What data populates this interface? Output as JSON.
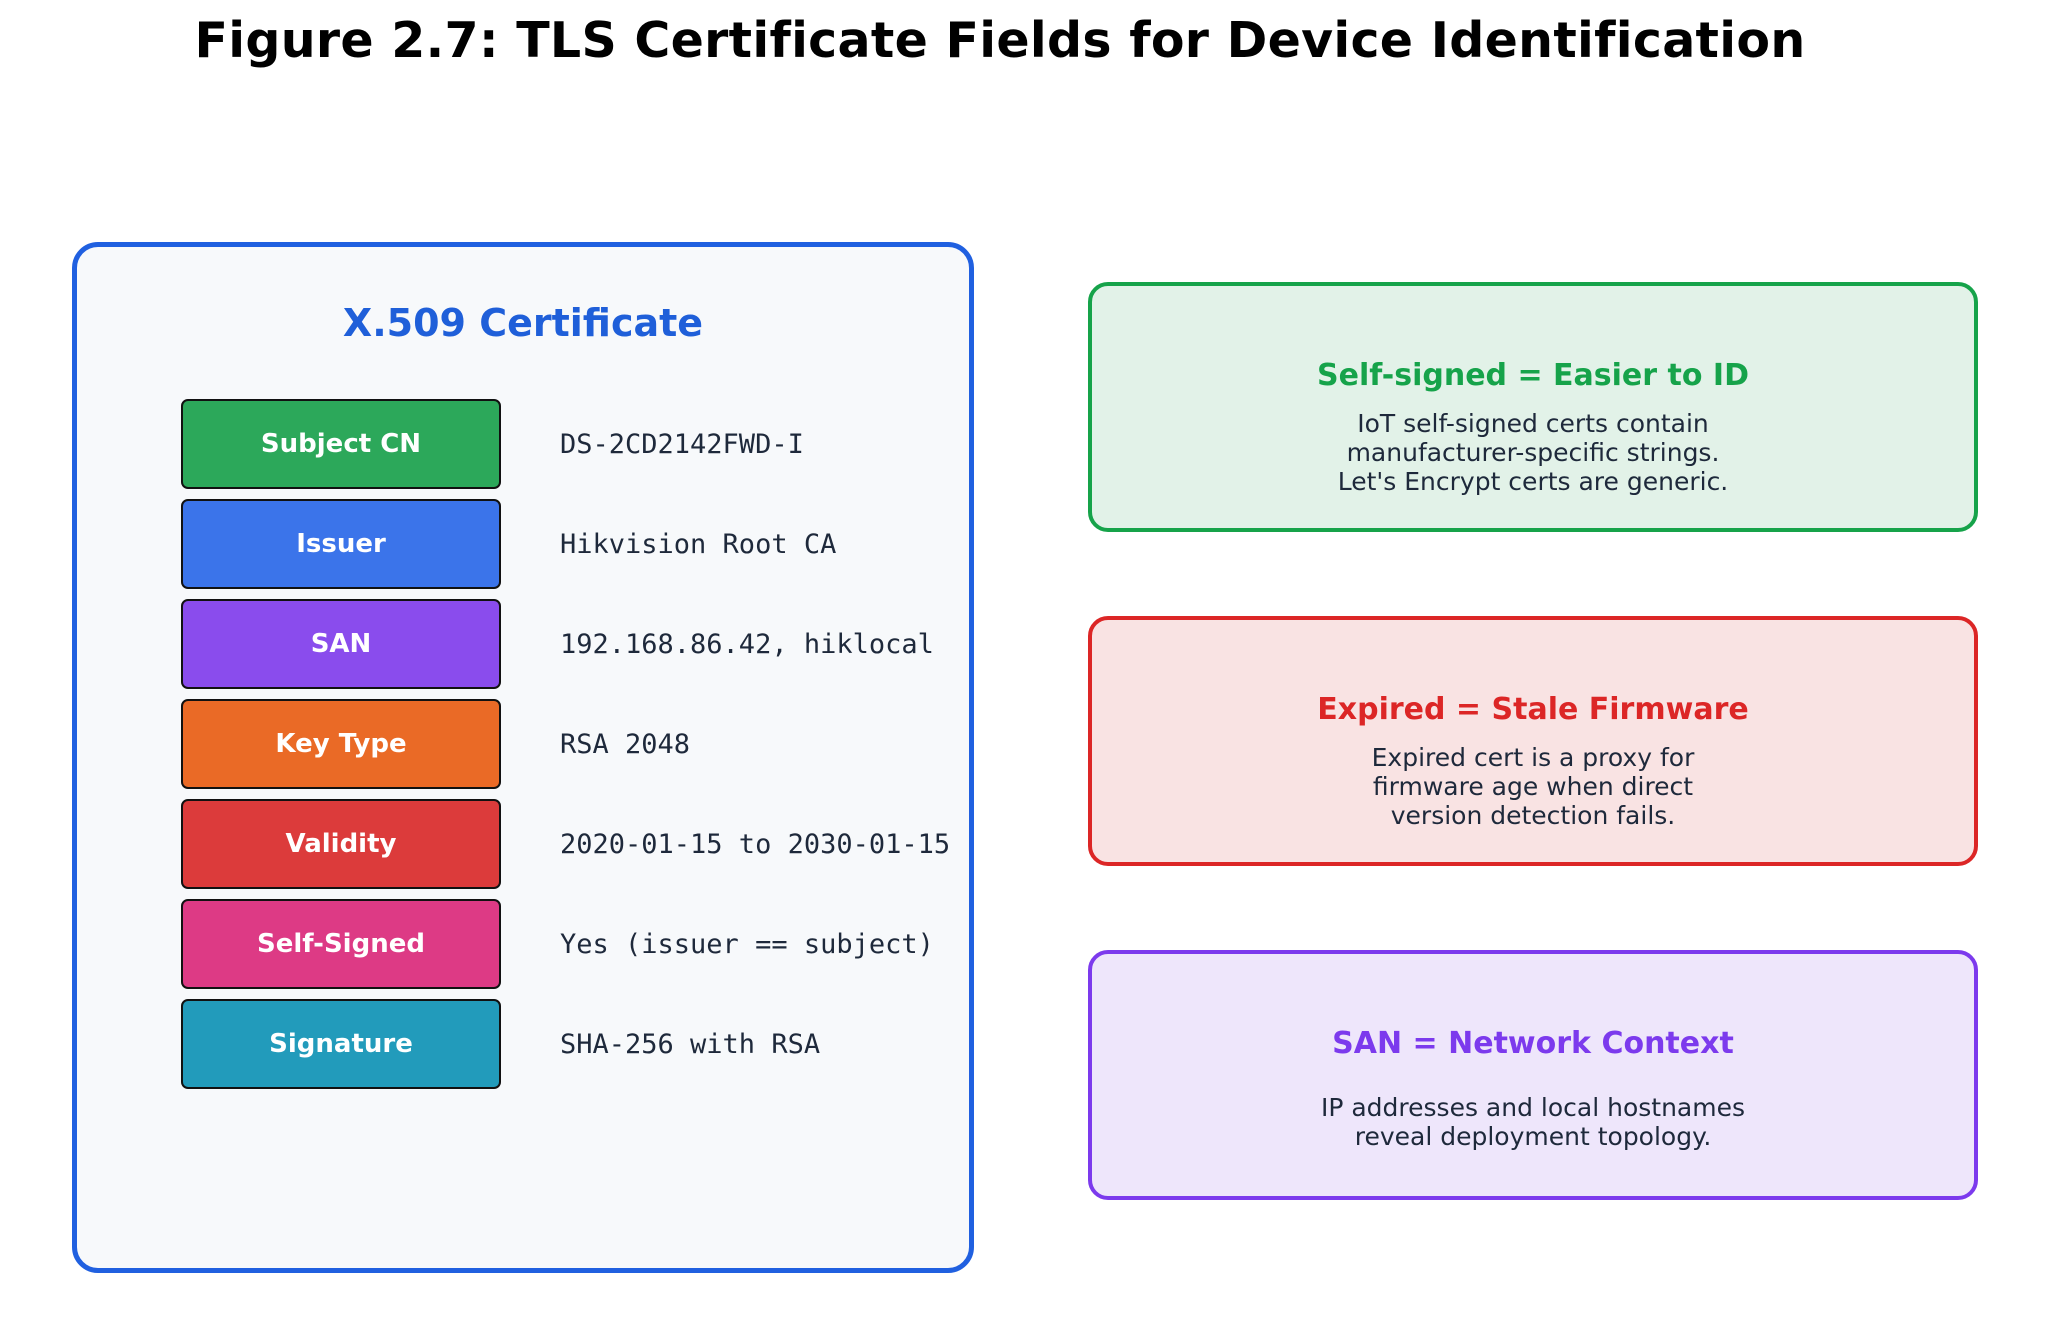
{
  "title": "Figure 2.7: TLS Certificate Fields for Device Identification",
  "certificate": {
    "heading": "X.509 Certificate",
    "fields": [
      {
        "label": "Subject CN",
        "value": "DS-2CD2142FWD-I",
        "color": "#2ca85a"
      },
      {
        "label": "Issuer",
        "value": "Hikvision Root CA",
        "color": "#3b74ea"
      },
      {
        "label": "SAN",
        "value": "192.168.86.42, hiklocal",
        "color": "#8a4ced"
      },
      {
        "label": "Key Type",
        "value": "RSA 2048",
        "color": "#ea6a26"
      },
      {
        "label": "Validity",
        "value": "2020-01-15 to 2030-01-15",
        "color": "#dc3b3b"
      },
      {
        "label": "Self-Signed",
        "value": "Yes (issuer == subject)",
        "color": "#dd3a85"
      },
      {
        "label": "Signature",
        "value": "SHA-256 with RSA",
        "color": "#229bbb"
      }
    ]
  },
  "notes": [
    {
      "title": "Self-signed = Easier to ID",
      "lines": [
        "IoT self-signed certs contain",
        "manufacturer-specific strings.",
        "Let's Encrypt certs are generic."
      ],
      "border_color": "#16a34a",
      "fill_color": "#e2f2e8",
      "title_color": "#16a34a"
    },
    {
      "title": "Expired = Stale Firmware",
      "lines": [
        "Expired cert is a proxy for",
        "firmware age when direct",
        "version detection fails."
      ],
      "border_color": "#dc2626",
      "fill_color": "#f9e3e3",
      "title_color": "#dc2626"
    },
    {
      "title": "SAN = Network Context",
      "lines": [
        "IP addresses and local hostnames",
        "reveal deployment topology."
      ],
      "border_color": "#7c3aed",
      "fill_color": "#eee6fb",
      "title_color": "#7c3aed"
    }
  ]
}
